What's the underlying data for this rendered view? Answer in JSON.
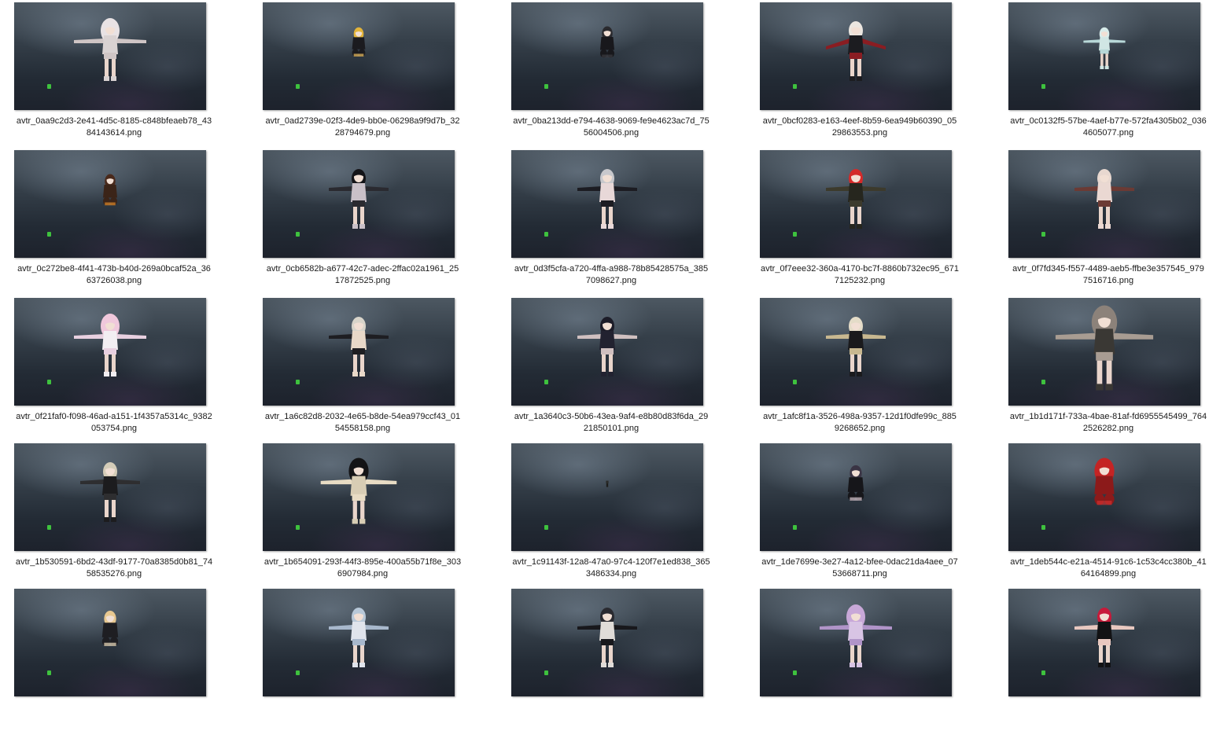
{
  "files": [
    {
      "name_line1": "avtr_0aa9c2d3-2e41-4d5c-8185-c848bfeaeb78_43",
      "name_line2": "84143614.png",
      "avatar": {
        "pose": "t-pose",
        "scale": 1.0,
        "hair": "#e8e2e4",
        "body": "#d9d2d2",
        "accent": "#cfc5c5",
        "wide": true
      }
    },
    {
      "name_line1": "avtr_0ad2739e-02f3-4de9-bb0e-06298a9f9d7b_32",
      "name_line2": "28794679.png",
      "avatar": {
        "pose": "crouch",
        "scale": 0.7,
        "hair": "#e3b43a",
        "body": "#1b1b1f",
        "accent": "#f0c060"
      }
    },
    {
      "name_line1": "avtr_0ba213dd-e794-4638-9069-fe9e4623ac7d_75",
      "name_line2": "56004506.png",
      "avatar": {
        "pose": "crouch",
        "scale": 0.75,
        "hair": "#2a2a2e",
        "body": "#18181c",
        "accent": "#3a3a40"
      }
    },
    {
      "name_line1": "avtr_0bcf0283-e163-4eef-8b59-6ea949b60390_05",
      "name_line2": "29863553.png",
      "avatar": {
        "pose": "a-pose",
        "scale": 1.0,
        "hair": "#ebe6e0",
        "body": "#1c1c20",
        "accent": "#8a1d22"
      }
    },
    {
      "name_line1": "avtr_0c0132f5-57be-4aef-b77e-572fa4305b02_036",
      "name_line2": "4605077.png",
      "avatar": {
        "pose": "t-pose",
        "scale": 0.7,
        "hair": "#d8ecea",
        "body": "#d0e6e4",
        "accent": "#b8d8d8"
      }
    },
    {
      "name_line1": "avtr_0c272be8-4f41-473b-b40d-269a0bcaf52a_36",
      "name_line2": "63726038.png",
      "avatar": {
        "pose": "crouch",
        "scale": 0.75,
        "hair": "#4a2a1c",
        "body": "#3b2418",
        "accent": "#e08a2a"
      }
    },
    {
      "name_line1": "avtr_0cb6582b-a677-42c7-adec-2ffac02a1961_25",
      "name_line2": "17872525.png",
      "avatar": {
        "pose": "t-pose",
        "scale": 1.0,
        "hair": "#141418",
        "body": "#c9c0c8",
        "accent": "#2a2a30"
      }
    },
    {
      "name_line1": "avtr_0d3f5cfa-a720-4ffa-a988-78b85428575a_385",
      "name_line2": "7098627.png",
      "avatar": {
        "pose": "t-pose",
        "scale": 1.0,
        "hair": "#c8c8cc",
        "body": "#e8d8d8",
        "accent": "#1c1c22"
      }
    },
    {
      "name_line1": "avtr_0f7eee32-360a-4170-bc7f-8860b732ec95_671",
      "name_line2": "7125232.png",
      "avatar": {
        "pose": "t-pose",
        "scale": 1.0,
        "hair": "#d42a2a",
        "body": "#26261e",
        "accent": "#3c3a2c"
      }
    },
    {
      "name_line1": "avtr_0f7fd345-f557-4489-aeb5-ffbe3e357545_979",
      "name_line2": "7516716.png",
      "avatar": {
        "pose": "t-pose",
        "scale": 1.0,
        "hair": "#e8d8d0",
        "body": "#ead8d2",
        "accent": "#6b3a34"
      }
    },
    {
      "name_line1": "avtr_0f21faf0-f098-46ad-a151-1f4357a5314c_9382",
      "name_line2": "053754.png",
      "avatar": {
        "pose": "t-pose",
        "scale": 1.0,
        "hair": "#f0c8dc",
        "body": "#f2eef2",
        "accent": "#e8d0e0",
        "wide": true
      }
    },
    {
      "name_line1": "avtr_1a6c82d8-2032-4e65-b8de-54ea979ccf43_01",
      "name_line2": "54558158.png",
      "avatar": {
        "pose": "t-pose",
        "scale": 1.0,
        "hair": "#d8d4ca",
        "body": "#e8d8c8",
        "accent": "#1e1e22"
      }
    },
    {
      "name_line1": "avtr_1a3640c3-50b6-43ea-9af4-e8b80d83f6da_29",
      "name_line2": "21850101.png",
      "avatar": {
        "pose": "t-pose",
        "scale": 1.0,
        "hair": "#1c1c28",
        "body": "#222230",
        "accent": "#d0c0c0"
      }
    },
    {
      "name_line1": "avtr_1afc8f1a-3526-498a-9357-12d1f0dfe99c_885",
      "name_line2": "9268652.png",
      "avatar": {
        "pose": "t-pose",
        "scale": 1.0,
        "hair": "#e4dcc8",
        "body": "#1a1a1c",
        "accent": "#c8b890"
      }
    },
    {
      "name_line1": "avtr_1b1d171f-733a-4bae-81af-fd6955545499_764",
      "name_line2": "2526282.png",
      "avatar": {
        "pose": "t-pose",
        "scale": 1.35,
        "hair": "#8c827a",
        "body": "#3a3834",
        "accent": "#a89c92",
        "wide": true
      }
    },
    {
      "name_line1": "avtr_1b530591-6bd2-43df-9177-70a8385d0b81_74",
      "name_line2": "58535276.png",
      "avatar": {
        "pose": "t-pose",
        "scale": 1.0,
        "hair": "#d4ccb8",
        "body": "#1c1c1e",
        "accent": "#2e2e30"
      }
    },
    {
      "name_line1": "avtr_1b654091-293f-44f3-895e-400a55b71f8e_303",
      "name_line2": "6907984.png",
      "avatar": {
        "pose": "t-pose",
        "scale": 1.05,
        "hair": "#141416",
        "body": "#d8cdb4",
        "accent": "#e8dcc4",
        "wide": true
      }
    },
    {
      "name_line1": "avtr_1c91143f-12a8-47a0-97c4-120f7e1ed838_365",
      "name_line2": "3486334.png",
      "avatar": {
        "pose": "tiny",
        "scale": 0.4,
        "hair": "#2a2a28",
        "body": "#1e1e1c",
        "accent": "#cfcfcf"
      }
    },
    {
      "name_line1": "avtr_1de7699e-3e27-4a12-bfee-0dac21da4aee_07",
      "name_line2": "53668711.png",
      "avatar": {
        "pose": "crouch",
        "scale": 0.85,
        "hair": "#3a3444",
        "body": "#16161a",
        "accent": "#d8c8d0"
      }
    },
    {
      "name_line1": "avtr_1deb544c-e21a-4514-91c6-1c53c4cc380b_41",
      "name_line2": "64164899.png",
      "avatar": {
        "pose": "crouch",
        "scale": 1.05,
        "hair": "#c42424",
        "body": "#8c1a1a",
        "accent": "#d03030",
        "wide": true
      }
    },
    {
      "name_line1": "",
      "name_line2": "",
      "avatar": {
        "pose": "crouch",
        "scale": 0.85,
        "hair": "#e8c890",
        "body": "#1e1e22",
        "accent": "#f0e0c0"
      }
    },
    {
      "name_line1": "",
      "name_line2": "",
      "avatar": {
        "pose": "t-pose",
        "scale": 1.0,
        "hair": "#b8c8d8",
        "body": "#e0e4ec",
        "accent": "#a8b8cc"
      }
    },
    {
      "name_line1": "",
      "name_line2": "",
      "avatar": {
        "pose": "t-pose",
        "scale": 1.0,
        "hair": "#2a2a30",
        "body": "#e0dcd8",
        "accent": "#18181c"
      }
    },
    {
      "name_line1": "",
      "name_line2": "",
      "avatar": {
        "pose": "t-pose",
        "scale": 1.0,
        "hair": "#c8a8d8",
        "body": "#d8c4e4",
        "accent": "#b094c8",
        "wide": true
      }
    },
    {
      "name_line1": "",
      "name_line2": "",
      "avatar": {
        "pose": "t-pose",
        "scale": 1.0,
        "hair": "#c81a3a",
        "body": "#121214",
        "accent": "#e8c8c0"
      }
    }
  ]
}
